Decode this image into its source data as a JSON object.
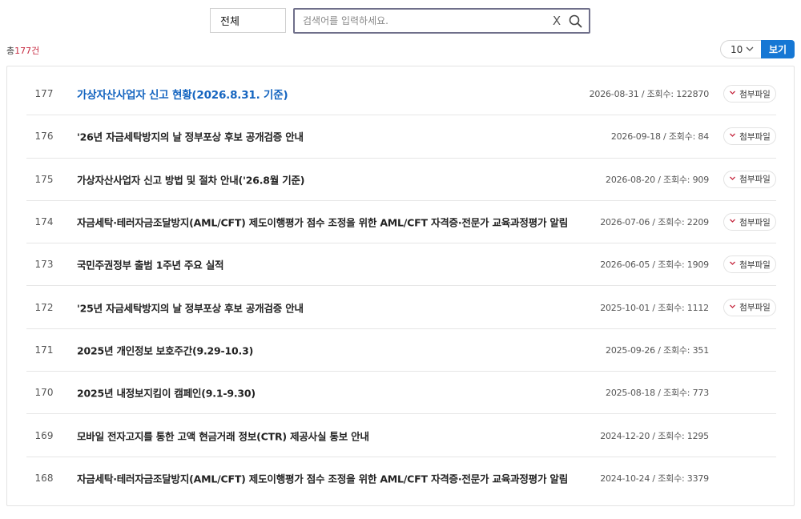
{
  "search": {
    "scope": "전체",
    "placeholder": "검색어를 입력하세요.",
    "value": "",
    "clear_glyph": "X",
    "icons": {
      "clear": "x-clear-icon",
      "search": "magnifier-search-icon"
    }
  },
  "summary": {
    "prefix": "총",
    "count": "177",
    "suffix": "건"
  },
  "pagination": {
    "page_size": "10",
    "view_label": "보기"
  },
  "colors": {
    "accent": "#1677d4",
    "count": "#c6283f",
    "highlight_title": "#1565c0",
    "attach_chevron": "#c6283f"
  },
  "posts": [
    {
      "no": "177",
      "title": "가상자산사업자 신고 현황(2026.8.31. 기준)",
      "meta": "2026-08-31 / 조회수: 122870",
      "attachment": "첨부파일"
    },
    {
      "no": "176",
      "title": "'26년 자금세탁방지의 날 정부포상 후보 공개검증 안내",
      "meta": "2026-09-18 / 조회수: 84",
      "attachment": "첨부파일"
    },
    {
      "no": "175",
      "title": "가상자산사업자 신고 방법 및 절차 안내('26.8월 기준)",
      "meta": "2026-08-20 / 조회수: 909",
      "attachment": "첨부파일"
    },
    {
      "no": "174",
      "title": "자금세탁·테러자금조달방지(AML/CFT) 제도이행평가 점수 조정을 위한 AML/CFT 자격증·전문가 교육과정평가 알림",
      "meta": "2026-07-06 / 조회수: 2209",
      "attachment": "첨부파일"
    },
    {
      "no": "173",
      "title": "국민주권정부 출범 1주년 주요 실적",
      "meta": "2026-06-05 / 조회수: 1909",
      "attachment": "첨부파일"
    },
    {
      "no": "172",
      "title": "'25년 자금세탁방지의 날 정부포상 후보 공개검증 안내",
      "meta": "2025-10-01 / 조회수: 1112",
      "attachment": "첨부파일"
    },
    {
      "no": "171",
      "title": "2025년 개인정보 보호주간(9.29-10.3)",
      "meta": "2025-09-26 / 조회수: 351",
      "attachment": ""
    },
    {
      "no": "170",
      "title": "2025년 내정보지킴이 캠페인(9.1-9.30)",
      "meta": "2025-08-18 / 조회수: 773",
      "attachment": ""
    },
    {
      "no": "169",
      "title": "모바일 전자고지를 통한 고액 현금거래 정보(CTR) 제공사실 통보 안내",
      "meta": "2024-12-20 / 조회수: 1295",
      "attachment": ""
    },
    {
      "no": "168",
      "title": "자금세탁·테러자금조달방지(AML/CFT) 제도이행평가 점수 조정을 위한 AML/CFT 자격증·전문가 교육과정평가 알림",
      "meta": "2024-10-24 / 조회수: 3379",
      "attachment": ""
    }
  ]
}
